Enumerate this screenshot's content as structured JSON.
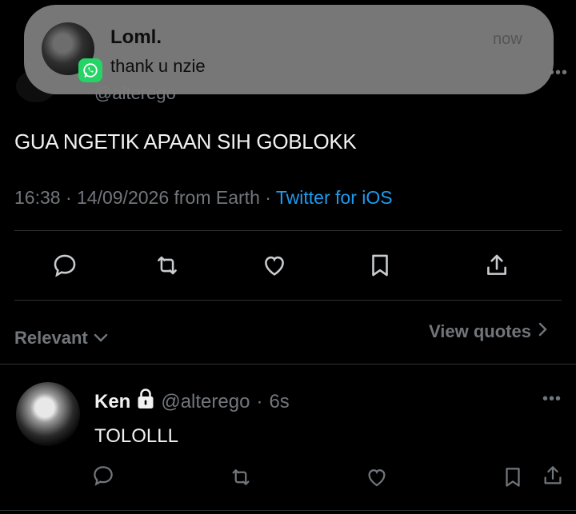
{
  "notification": {
    "sender": "Loml.",
    "message": "thank u nzie",
    "time": "now",
    "app_icon": "whatsapp-icon"
  },
  "tweet": {
    "partial_handle": "@alterego",
    "text": "GUA NGETIK APAAN SIH GOBLOKK",
    "timestamp": "16:38 · 14/09/2026 from Earth · ",
    "source": "Twitter for iOS",
    "actions": [
      "reply-icon",
      "retweet-icon",
      "like-icon",
      "bookmark-icon",
      "share-icon"
    ]
  },
  "sort": {
    "label": "Relevant",
    "view_quotes": "View quotes"
  },
  "reply": {
    "name": "Ken",
    "handle": "@alterego",
    "separator": "·",
    "time": "6s",
    "text": "TOLOLLL"
  },
  "colors": {
    "background": "#000000",
    "text": "#e7e9ea",
    "muted": "#71767b",
    "link": "#1d9bf0",
    "divider": "#2f3336",
    "whatsapp": "#25d366"
  }
}
